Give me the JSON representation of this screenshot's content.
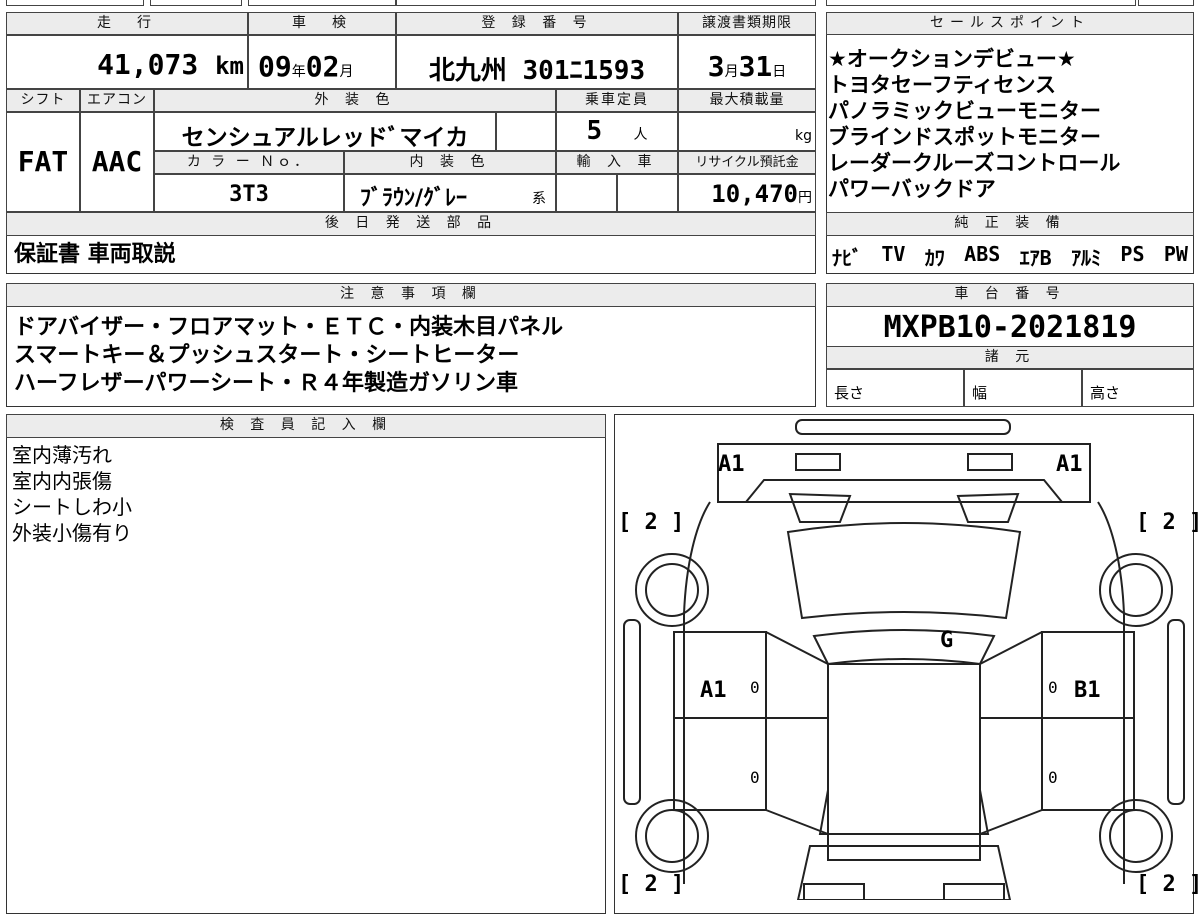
{
  "summary": {
    "mileage_header": "走　行",
    "mileage_value": "41,073",
    "mileage_unit": "km",
    "inspection_header": "車　検",
    "inspection_year": "09",
    "inspection_year_unit": "年",
    "inspection_month": "02",
    "inspection_month_unit": "月",
    "registration_header": "登 録 番 号",
    "registration_value": "北九州 301ﾆ1593",
    "transfer_header": "譲渡書類期限",
    "transfer_month": "3",
    "transfer_month_unit": "月",
    "transfer_day": "31",
    "transfer_day_unit": "日"
  },
  "specs": {
    "shift_header": "シフト",
    "shift_value": "FAT",
    "ac_header": "エアコン",
    "ac_value": "AAC",
    "exterior_header": "外 装 色",
    "exterior_value": "センシュアルレッドﾞマイカ",
    "capacity_header": "乗車定員",
    "capacity_value": "5",
    "capacity_unit": "人",
    "maxload_header": "最大積載量",
    "maxload_unit": "kg",
    "color_no_header": "カ ラ ー Ｎｏ．",
    "color_no_value": "3T3",
    "interior_header": "内 装 色",
    "interior_value": "ﾌﾞﾗｳﾝ/ｸﾞﾚｰ",
    "interior_suffix": "系",
    "import_header": "輸 入 車",
    "recycle_header": "リサイクル預託金",
    "recycle_value": "10,470",
    "recycle_unit": "円"
  },
  "later_parts": {
    "header": "後 日 発 送 部 品",
    "value": "保証書 車両取説"
  },
  "sales_points": {
    "header": "セールスポイント",
    "items": [
      "★オークションデビュー★",
      "トヨタセーフティセンス",
      "パノラミックビューモニター",
      "ブラインドスポットモニター",
      "レーダークルーズコントロール",
      "パワーバックドア"
    ]
  },
  "equipment": {
    "header": "純 正 装 備",
    "items": [
      "ﾅﾋﾞ",
      "TV",
      "ｶﾜ",
      "ABS",
      "ｴｱB",
      "ｱﾙﾐ",
      "PS",
      "PW"
    ]
  },
  "notes": {
    "header": "注 意 事 項 欄",
    "lines": [
      "ドアバイザー・フロアマット・ＥＴＣ・内装木目パネル",
      "スマートキー＆プッシュスタート・シートヒーター",
      "ハーフレザーパワーシート・Ｒ４年製造ガソリン車"
    ]
  },
  "chassis": {
    "header": "車 台 番 号",
    "value": "MXPB10-2021819"
  },
  "dimensions": {
    "header": "諸 元",
    "length_label": "長さ",
    "width_label": "幅",
    "height_label": "高さ"
  },
  "inspector": {
    "header": "検 査 員 記 入 欄",
    "lines": [
      "室内薄汚れ",
      "室内内張傷",
      "シートしわ小",
      "外装小傷有り"
    ]
  },
  "diagram": {
    "labels": {
      "front_left": "A1",
      "front_right": "A1",
      "windshield": "G",
      "left_front_door": "A1",
      "right_front_door": "B1",
      "door_zero_1": "0",
      "door_zero_2": "0",
      "door_zero_3": "0",
      "door_zero_4": "0",
      "tire_fl": "[ 2 ]",
      "tire_fr": "[ 2 ]",
      "tire_rl": "[ 2 ]",
      "tire_rr": "[ 2 ]"
    }
  },
  "colors": {
    "border": "#333333",
    "header_bg": "#ececec",
    "text": "#000000"
  }
}
